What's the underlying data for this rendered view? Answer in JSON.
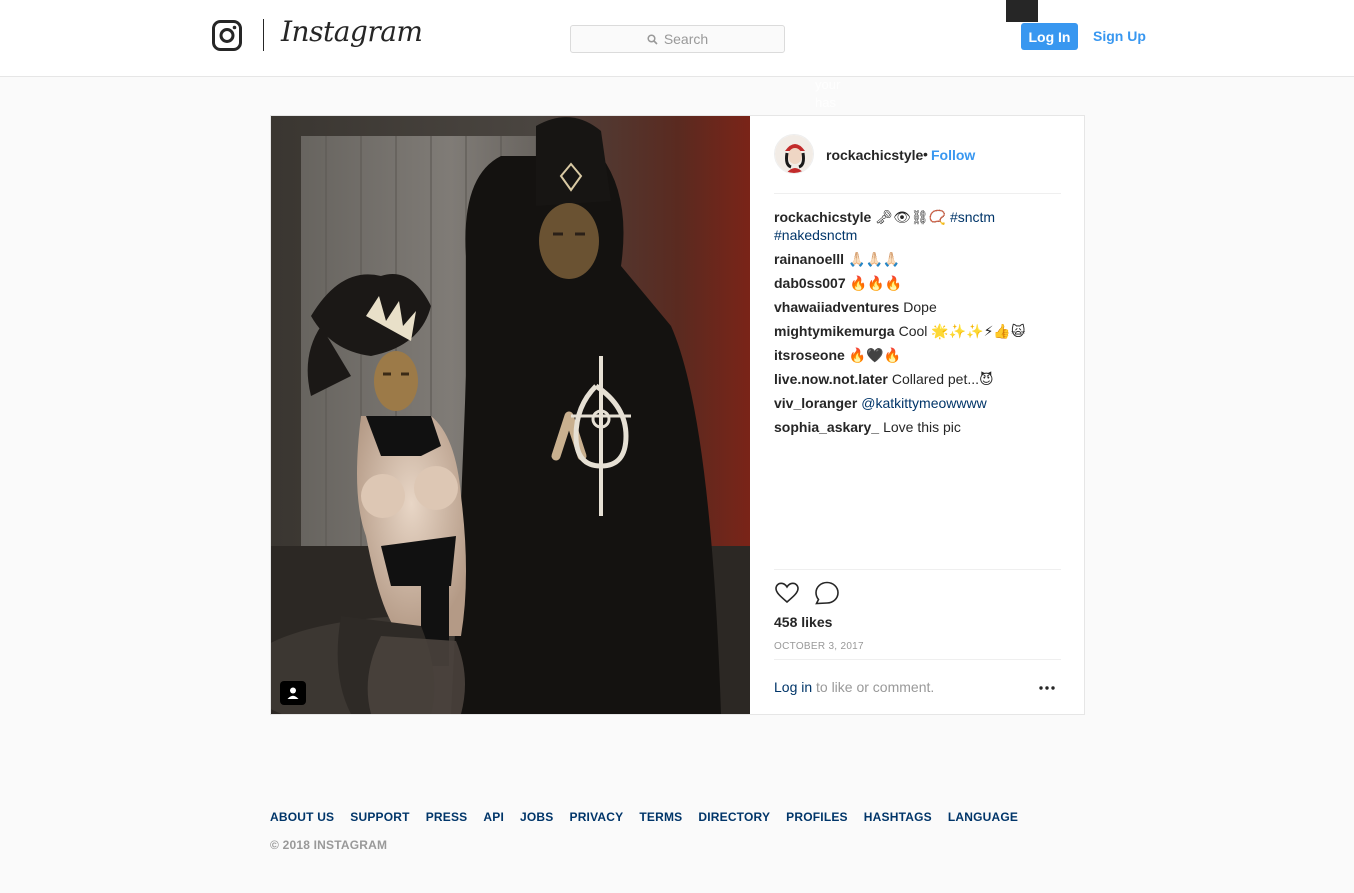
{
  "header": {
    "brand": "Instagram",
    "search_placeholder": "Search",
    "login_label": "Log In",
    "signup_label": "Sign Up",
    "ghost_lines": [
      "your",
      "has"
    ]
  },
  "post": {
    "owner": "rockachicstyle",
    "separator": "•",
    "follow_label": "Follow",
    "caption": {
      "user": "rockachicstyle",
      "emoji": "🗝👁⛓📿",
      "tags": [
        "#snctm",
        "#nakedsnctm"
      ]
    },
    "comments": [
      {
        "user": "rainanoelll",
        "text": "🙏🏻🙏🏻🙏🏻"
      },
      {
        "user": "dab0ss007",
        "text": "🔥🔥🔥"
      },
      {
        "user": "vhawaiiadventures",
        "text": "Dope"
      },
      {
        "user": "mightymikemurga",
        "text": "Cool 🌟✨✨⚡👍🙀"
      },
      {
        "user": "itsroseone",
        "text": "🔥🖤🔥"
      },
      {
        "user": "live.now.not.later",
        "text": "Collared pet...😈"
      },
      {
        "user": "viv_loranger",
        "mention": "@katkittymeowwww"
      },
      {
        "user": "sophia_askary_",
        "text": "Love this pic"
      }
    ],
    "likes": "458 likes",
    "date": "OCTOBER 3, 2017",
    "login_link": "Log in",
    "login_rest": "to like or comment."
  },
  "footer": {
    "links": [
      "ABOUT US",
      "SUPPORT",
      "PRESS",
      "API",
      "JOBS",
      "PRIVACY",
      "TERMS",
      "DIRECTORY",
      "PROFILES",
      "HASHTAGS",
      "LANGUAGE"
    ],
    "copyright": "© 2018 INSTAGRAM"
  },
  "colors": {
    "accent": "#3897f0",
    "link_dark": "#003569",
    "muted": "#999999",
    "text": "#262626"
  },
  "icons": [
    "instagram-glyph-icon",
    "search-icon",
    "user-tag-icon",
    "heart-icon",
    "comment-icon",
    "more-options-icon"
  ]
}
